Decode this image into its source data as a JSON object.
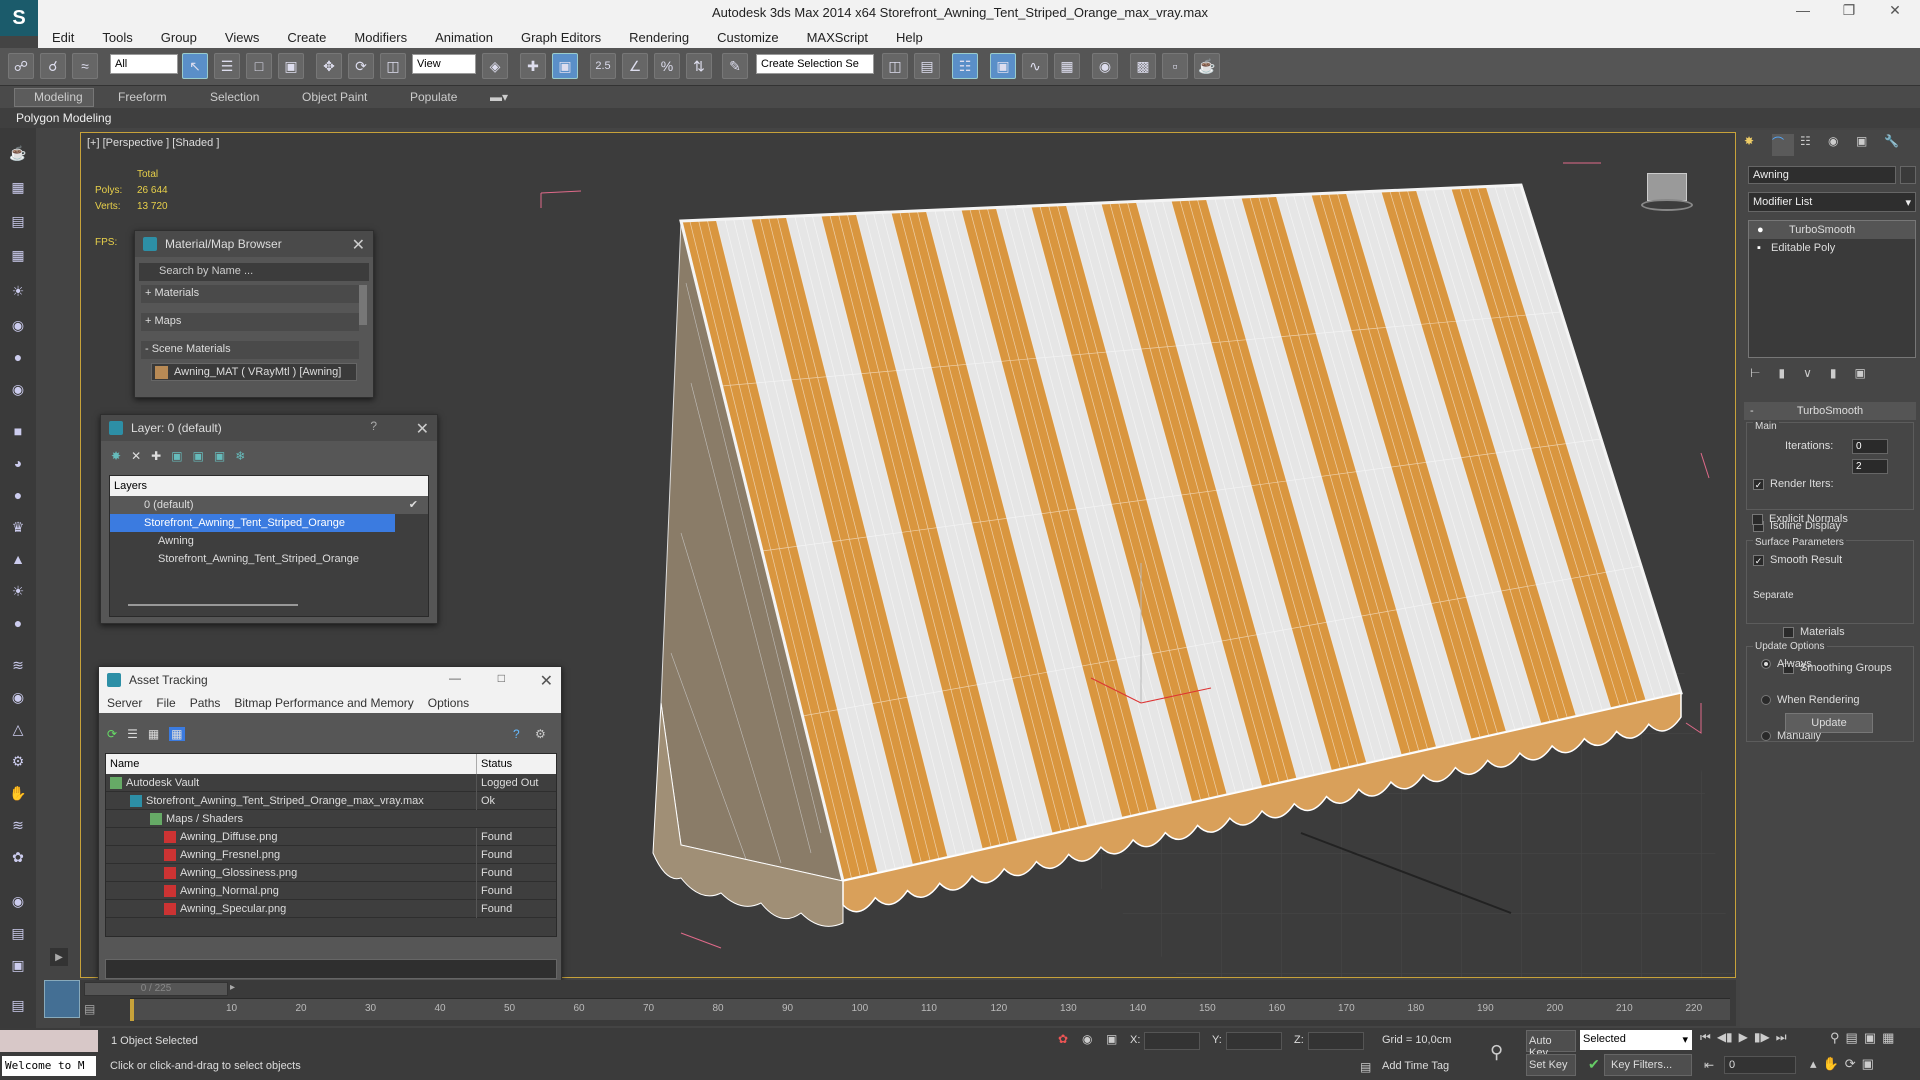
{
  "title": "Autodesk 3ds Max  2014 x64    Storefront_Awning_Tent_Striped_Orange_max_vray.max",
  "menu": [
    "Edit",
    "Tools",
    "Group",
    "Views",
    "Create",
    "Modifiers",
    "Animation",
    "Graph Editors",
    "Rendering",
    "Customize",
    "MAXScript",
    "Help"
  ],
  "toolbar": {
    "filter": "All",
    "refcoord": "View",
    "snap_pct": "2.5",
    "selection_set": "Create Selection Se"
  },
  "ribbon": {
    "tabs": [
      "Modeling",
      "Freeform",
      "Selection",
      "Object Paint",
      "Populate"
    ],
    "sub": "Polygon Modeling"
  },
  "viewport": {
    "label": "[+] [Perspective ] [Shaded ]",
    "stats_title": "Total",
    "polys_label": "Polys:",
    "polys": "26 644",
    "verts_label": "Verts:",
    "verts": "13 720",
    "fps_label": "FPS:"
  },
  "mat_browser": {
    "title": "Material/Map Browser",
    "search": "Search by Name ...",
    "sections": [
      "+ Materials",
      "+ Maps",
      "- Scene Materials"
    ],
    "item": "Awning_MAT  ( VRayMtl )  [Awning]"
  },
  "layer": {
    "title": "Layer: 0 (default)",
    "col": "Layers",
    "rows": [
      "0 (default)",
      "Storefront_Awning_Tent_Striped_Orange",
      "Awning",
      "Storefront_Awning_Tent_Striped_Orange"
    ]
  },
  "asset": {
    "title": "Asset Tracking",
    "menu": [
      "Server",
      "File",
      "Paths",
      "Bitmap Performance and Memory",
      "Options"
    ],
    "col_name": "Name",
    "col_status": "Status",
    "rows": [
      {
        "name": "Autodesk Vault",
        "status": "Logged Out"
      },
      {
        "name": "Storefront_Awning_Tent_Striped_Orange_max_vray.max",
        "status": "Ok"
      },
      {
        "name": "Maps / Shaders",
        "status": ""
      },
      {
        "name": "Awning_Diffuse.png",
        "status": "Found"
      },
      {
        "name": "Awning_Fresnel.png",
        "status": "Found"
      },
      {
        "name": "Awning_Glossiness.png",
        "status": "Found"
      },
      {
        "name": "Awning_Normal.png",
        "status": "Found"
      },
      {
        "name": "Awning_Specular.png",
        "status": "Found"
      }
    ]
  },
  "cmd": {
    "name": "Awning",
    "modlist": "Modifier List",
    "stack": [
      "TurboSmooth",
      "Editable Poly"
    ],
    "rollout": "TurboSmooth",
    "main": "Main",
    "iterations_label": "Iterations:",
    "iterations": "0",
    "render_iters_label": "Render Iters:",
    "render_iters": "2",
    "isoline": "Isoline Display",
    "explicit": "Explicit Normals",
    "surface": "Surface Parameters",
    "smooth": "Smooth Result",
    "separate": "Separate",
    "materials": "Materials",
    "smoothing": "Smoothing Groups",
    "update_opts": "Update Options",
    "always": "Always",
    "when_rendering": "When Rendering",
    "manually": "Manually",
    "update_btn": "Update"
  },
  "timeline": {
    "frame": "0 / 225",
    "ticks": [
      "10",
      "20",
      "30",
      "40",
      "50",
      "60",
      "70",
      "80",
      "90",
      "100",
      "110",
      "120",
      "130",
      "140",
      "150",
      "160",
      "170",
      "180",
      "190",
      "200",
      "210",
      "220"
    ]
  },
  "status": {
    "selected": "1 Object Selected",
    "hint": "Click or click-and-drag to select objects",
    "welcome": "Welcome to M",
    "x": "X:",
    "y": "Y:",
    "z": "Z:",
    "grid": "Grid = 10,0cm",
    "autokey": "Auto Key",
    "setkey": "Set Key",
    "selected_dd": "Selected",
    "keyfilters": "Key Filters...",
    "addtime": "Add Time Tag",
    "frame_field": "0"
  }
}
